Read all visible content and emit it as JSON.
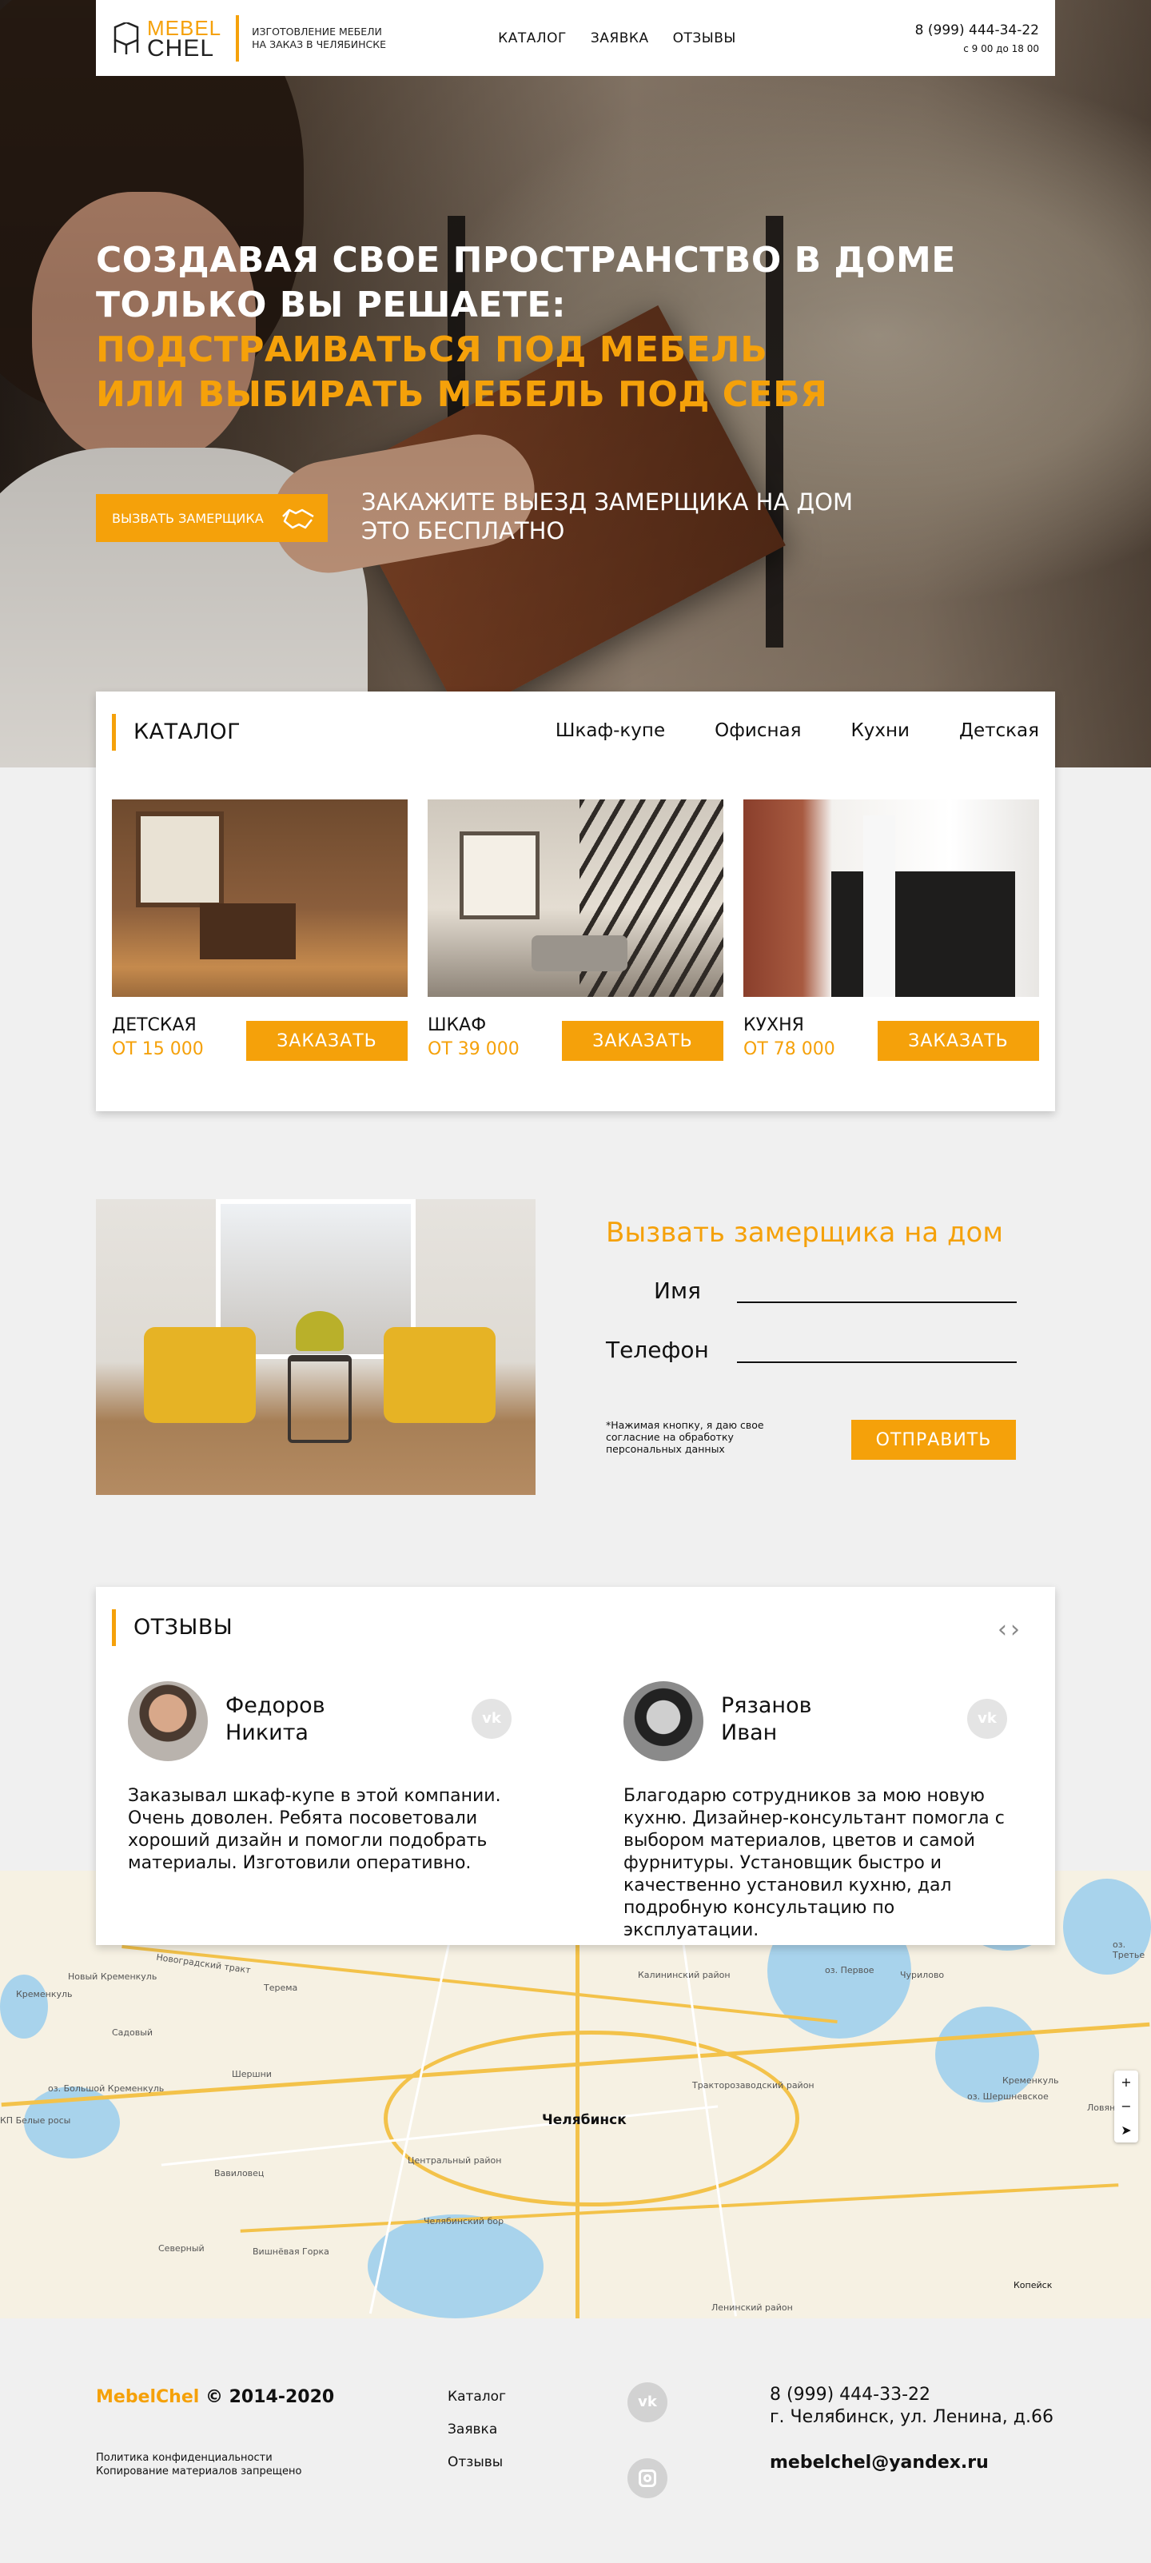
{
  "header": {
    "logo_top": "MEBEL",
    "logo_bottom": "CHEL",
    "tagline_1": "ИЗГОТОВЛЕНИЕ МЕБЕЛИ",
    "tagline_2": "НА ЗАКАЗ В ЧЕЛЯБИНСКЕ",
    "nav": [
      "КАТАЛОГ",
      "ЗАЯВКА",
      "ОТЗЫВЫ"
    ],
    "phone": "8 (999) 444-34-22",
    "hours": "с 9 00 до 18 00"
  },
  "hero": {
    "line1": "СОЗДАВАЯ СВОЕ ПРОСТРАНСТВО В ДОМЕ",
    "line2": "ТОЛЬКО ВЫ РЕШАЕТЕ:",
    "line3": "ПОДСТРАИВАТЬСЯ ПОД МЕБЕЛЬ",
    "line4": "ИЛИ ВЫБИРАТЬ МЕБЕЛЬ ПОД СЕБЯ",
    "cta_label": "ВЫЗВАТЬ ЗАМЕРЩИКА",
    "note_1": "ЗАКАЖИТЕ ВЫЕЗД ЗАМЕРЩИКА НА ДОМ",
    "note_2": "ЭТО БЕСПЛАТНО"
  },
  "catalog": {
    "title": "КАТАЛОГ",
    "tabs": [
      "Шкаф-купе",
      "Офисная",
      "Кухни",
      "Детская"
    ],
    "products": [
      {
        "name": "ДЕТСКАЯ",
        "price": "ОТ 15 000",
        "button": "ЗАКАЗАТЬ"
      },
      {
        "name": "ШКАФ",
        "price": "ОТ 39 000",
        "button": "ЗАКАЗАТЬ"
      },
      {
        "name": "КУХНЯ",
        "price": "ОТ 78 000",
        "button": "ЗАКАЗАТЬ"
      }
    ]
  },
  "request": {
    "title": "Вызвать замерщика на дом",
    "name_label": "Имя",
    "phone_label": "Телефон",
    "consent": "*Нажимая кнопку, я даю свое согласние   на обработку персональных данных",
    "submit": "ОТПРАВИТЬ"
  },
  "reviews": {
    "title": "ОТЗЫВЫ",
    "items": [
      {
        "first": "Федоров",
        "last": "Никита",
        "text": "Заказывал шкаф-купе в этой компании. Очень доволен. Ребята посоветовали хороший дизайн и помогли подобрать материалы. Изготовили оперативно."
      },
      {
        "first": "Рязанов",
        "last": "Иван",
        "text": "Благодарю сотрудников за мою новую кухню. Дизайнер-консультант помогла с выбором материалов, цветов и самой фурнитуры. Установщик быстро и качественно установил кухню, дал подробную консультацию по эксплуатации."
      }
    ]
  },
  "map": {
    "city": "Челябинск",
    "labels": [
      "Новый Кременкуль",
      "Кременкуль",
      "Садовый",
      "оз. Большой Кременкуль",
      "КП Белые росы",
      "Новоградский тракт",
      "Терема",
      "Шершни",
      "Вавиловец",
      "Северный",
      "Вишнёвая Горка",
      "Центральный район",
      "Челябинский бор",
      "Калининский район",
      "Тракторозаводский район",
      "Ленинский район",
      "Копейск",
      "оз. Первое",
      "Чурилово",
      "оз. Шершневское",
      "Кременкуль",
      "Ловянский",
      "оз. Третье"
    ]
  },
  "footer": {
    "brand": "MebelChel",
    "copyright": " © 2014-2020",
    "legal_1": "Политика конфиденциальности",
    "legal_2": "Копирование материалов запрещено",
    "links": [
      "Каталог",
      "Заявка",
      "Отзывы"
    ],
    "phone": "8 (999) 444-33-22",
    "address": "г. Челябинск, ул. Ленина, д.66",
    "email": "mebelchel@yandex.ru"
  },
  "colors": {
    "accent": "#f5a10a",
    "text": "#111111",
    "background": "#f0f0f0"
  },
  "icons": [
    "logo-chair-icon",
    "handshake-icon",
    "vk-icon",
    "instagram-icon",
    "chevron-left-icon",
    "chevron-right-icon"
  ]
}
